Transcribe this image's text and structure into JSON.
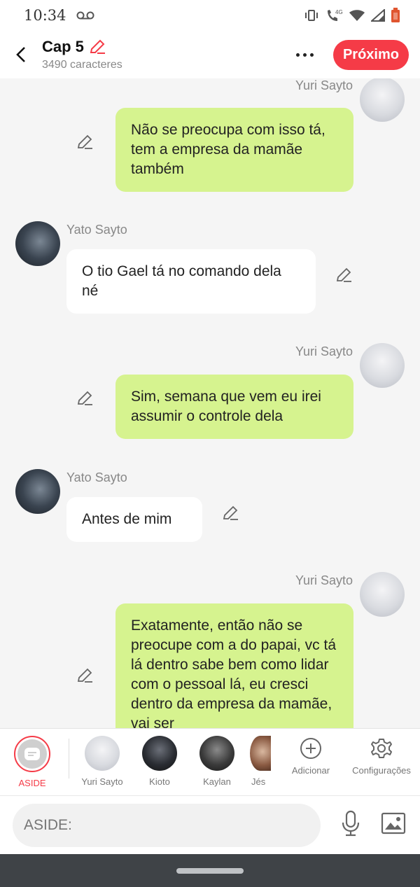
{
  "status": {
    "time": "10:34",
    "network": "4G"
  },
  "header": {
    "title": "Cap 5",
    "subtitle": "3490 caracteres",
    "next_label": "Próximo"
  },
  "messages": [
    {
      "sender": "Yuri Sayto",
      "text": "Não se preocupa com isso tá, tem a empresa da mamãe também"
    },
    {
      "sender": "Yato Sayto",
      "text": "O tio Gael tá no comando dela né"
    },
    {
      "sender": "Yuri Sayto",
      "text": "Sim, semana que vem eu irei assumir o controle dela"
    },
    {
      "sender": "Yato Sayto",
      "text": "Antes de mim"
    },
    {
      "sender": "Yuri Sayto",
      "text": "Exatamente, então não se preocupe com a do papai, vc tá lá dentro sabe bem como lidar com o pessoal lá, eu cresci dentro da empresa da mamãe, vai ser"
    }
  ],
  "characters": [
    {
      "label": "ASIDE"
    },
    {
      "label": "Yuri Sayto"
    },
    {
      "label": "Kioto"
    },
    {
      "label": "Kaylan"
    },
    {
      "label": "Jés"
    }
  ],
  "actions": {
    "add_label": "Adicionar",
    "settings_label": "Configurações"
  },
  "input": {
    "placeholder": "ASIDE:"
  },
  "colors": {
    "accent": "#f53b47",
    "own_bubble": "#d6f38f",
    "other_bubble": "#ffffff"
  }
}
